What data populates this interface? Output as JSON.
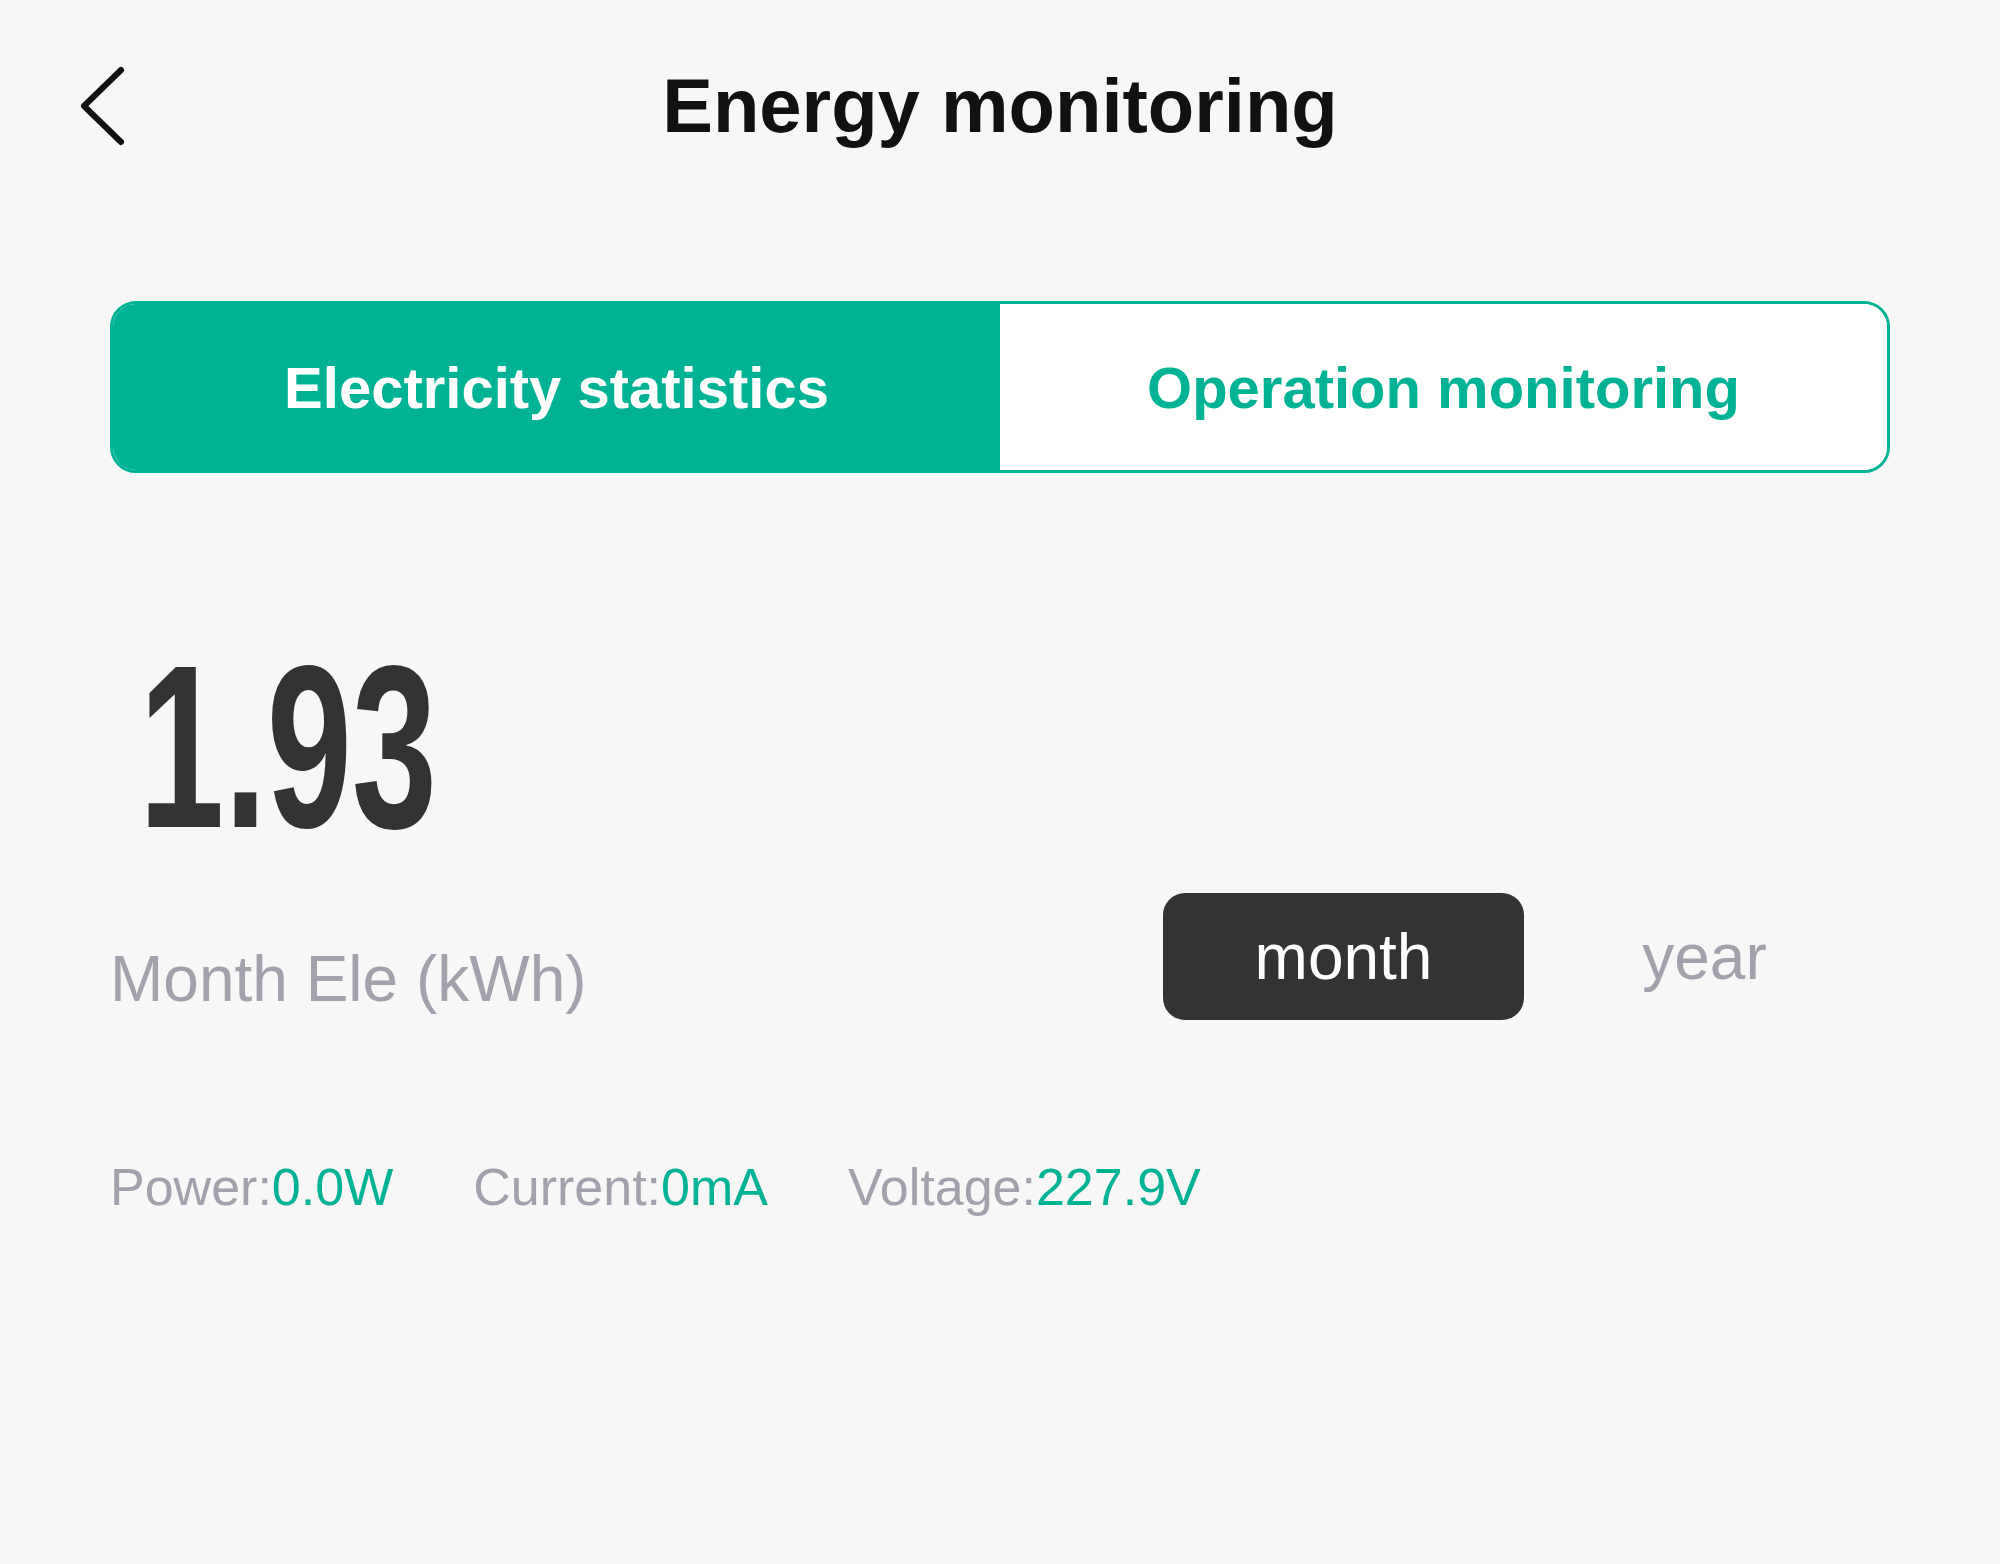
{
  "header": {
    "title": "Energy monitoring"
  },
  "tabs": [
    {
      "label": "Electricity statistics",
      "selected": true
    },
    {
      "label": "Operation monitoring",
      "selected": false
    }
  ],
  "summary": {
    "value": "1.93",
    "label": "Month Ele (kWh)"
  },
  "periods": [
    {
      "label": "month",
      "selected": true
    },
    {
      "label": "year",
      "selected": false
    }
  ],
  "readings": [
    {
      "label": "Power:",
      "value": "0.0W"
    },
    {
      "label": "Current:",
      "value": "0mA"
    },
    {
      "label": "Voltage:",
      "value": "227.9V"
    }
  ]
}
